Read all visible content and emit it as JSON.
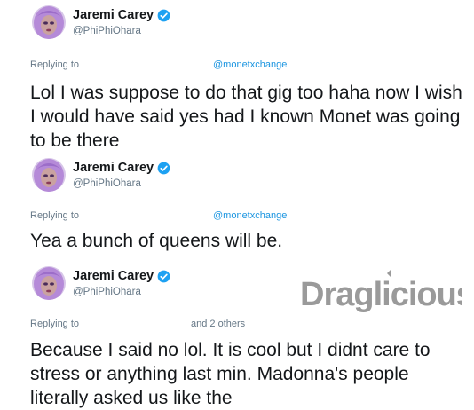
{
  "tweets": [
    {
      "author_name": "Jaremi Carey",
      "author_handle": "@PhiPhiOhara",
      "replying_label": "Replying to",
      "replying_to": "@monetxchange",
      "text": "Lol I was suppose to do that gig too haha now I wish I would have said yes had I known Monet was going to be there"
    },
    {
      "author_name": "Jaremi Carey",
      "author_handle": "@PhiPhiOhara",
      "replying_label": "Replying to",
      "replying_to": "@monetxchange",
      "text": "Yea a bunch of queens will be."
    },
    {
      "author_name": "Jaremi Carey",
      "author_handle": "@PhiPhiOhara",
      "replying_label": "Replying to",
      "replying_others": "and 2 others",
      "text": "Because I said no lol. It is cool but I didnt care to stress or anything last min. Madonna's people literally asked us like the"
    }
  ],
  "watermark": {
    "text": "Draglicious",
    "color": "#9a9a9a"
  },
  "icons": {
    "verified": "verified-badge-icon",
    "avatar": "profile-avatar"
  },
  "colors": {
    "link": "#1b95e0",
    "secondary_text": "#657786",
    "primary_text": "#14171a",
    "verified": "#1da1f2",
    "avatar_hair": "#b58ad8"
  }
}
